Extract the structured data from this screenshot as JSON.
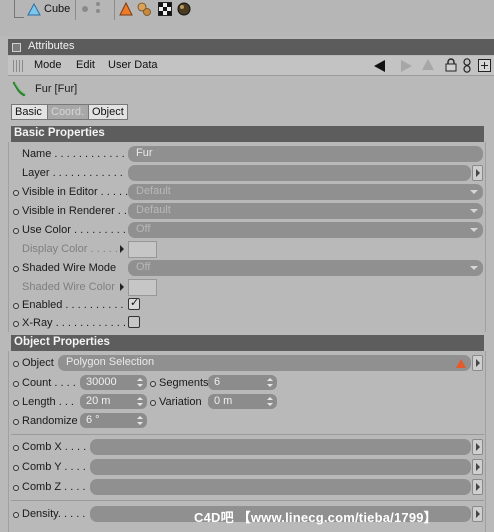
{
  "top_strip": {
    "object_name": "Cube",
    "tag_icons": [
      "phong-tag-icon",
      "material-balls-icon",
      "checker-texture-icon",
      "material-sphere-icon"
    ]
  },
  "attributes": {
    "title": "Attributes",
    "menu": [
      "Mode",
      "Edit",
      "User Data"
    ]
  },
  "object": {
    "title": "Fur [Fur]"
  },
  "tabs": [
    {
      "label": "Basic",
      "active": true
    },
    {
      "label": "Coord.",
      "active": false
    },
    {
      "label": "Object",
      "active": true
    }
  ],
  "basic_properties": {
    "header": "Basic Properties",
    "name_label": "Name . . . . . . . . . . . .",
    "name_value": "Fur",
    "layer_label": "Layer . . . . . . . . . . . .",
    "layer_value": "",
    "visible_editor_label": "Visible in Editor . . . . .",
    "visible_editor_value": "Default",
    "visible_renderer_label": "Visible in Renderer . .",
    "visible_renderer_value": "Default",
    "use_color_label": "Use Color . . . . . . . . .",
    "use_color_value": "Off",
    "display_color_label": "Display Color . . . . .",
    "shaded_wire_mode_label": "Shaded Wire Mode",
    "shaded_wire_mode_value": "Off",
    "shaded_wire_color_label": "Shaded Wire Color",
    "enabled_label": "Enabled . . . . . . . . . .",
    "enabled_checked": true,
    "xray_label": "X-Ray . . . . . . . . . . . .",
    "xray_checked": false
  },
  "object_properties": {
    "header": "Object Properties",
    "object_label": "Object",
    "object_value": "Polygon Selection",
    "count_label": "Count . . . .",
    "count_value": "30000",
    "segments_label": "Segments",
    "segments_value": "6",
    "length_label": "Length . . .",
    "length_value": "20 m",
    "variation_label": "Variation",
    "variation_value": "0 m",
    "randomize_label": "Randomize",
    "randomize_value": "6 °",
    "comb_x_label": "Comb X . . . .",
    "comb_y_label": "Comb Y . . . .",
    "comb_z_label": "Comb Z . . . .",
    "density_label": "Density. . . . ."
  },
  "watermark": "C4D吧 【www.linecg.com/tieba/1799】",
  "colors": {
    "panel_bg": "#b9b9b9",
    "group_header": "#5d5d5d",
    "field": "#909090",
    "warning": "#e55a2a"
  }
}
